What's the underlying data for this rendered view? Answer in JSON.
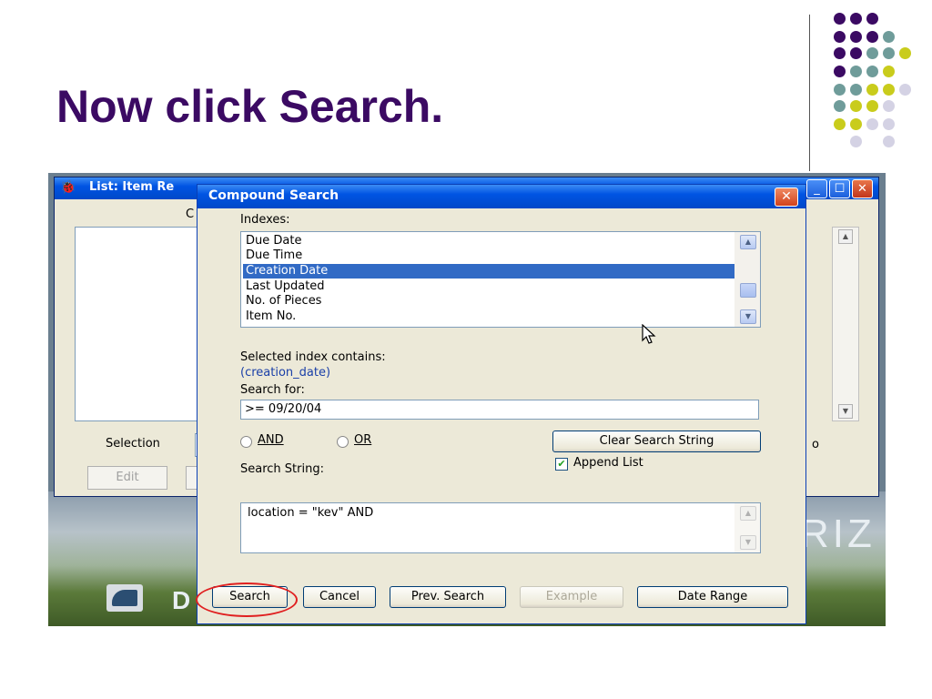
{
  "slide": {
    "title": "Now click Search."
  },
  "decor": {
    "dot_colors": {
      "purple": "#3b0a63",
      "teal": "#6f9c9a",
      "yellow": "#c9cc1c",
      "lavender": "#d4d2e4"
    }
  },
  "back_window": {
    "title": "List: Item Re",
    "column_label_partial": "C",
    "selection_label": "Selection",
    "edit_label": "Edit",
    "right_partial": "o"
  },
  "background": {
    "text": "RIZ",
    "logo_letter": "D"
  },
  "dialog": {
    "title": "Compound Search",
    "indexes_label": "Indexes:",
    "indexes": [
      "Due Date",
      "Due Time",
      "Creation Date",
      "Last Updated",
      "No. of Pieces",
      "Item No."
    ],
    "selected_index": "Creation Date",
    "selected_contains_label": "Selected index contains:",
    "selected_contains_value": "(creation_date)",
    "search_for_label": "Search for:",
    "search_for_value": ">= 09/20/04",
    "and_label": "AND",
    "or_label": "OR",
    "clear_button": "Clear Search String",
    "append_list_label": "Append List",
    "search_string_label": "Search String:",
    "search_string_value": "location = \"kev\" AND",
    "buttons": {
      "search": "Search",
      "cancel": "Cancel",
      "prev_search": "Prev. Search",
      "example": "Example",
      "date_range": "Date Range"
    }
  }
}
